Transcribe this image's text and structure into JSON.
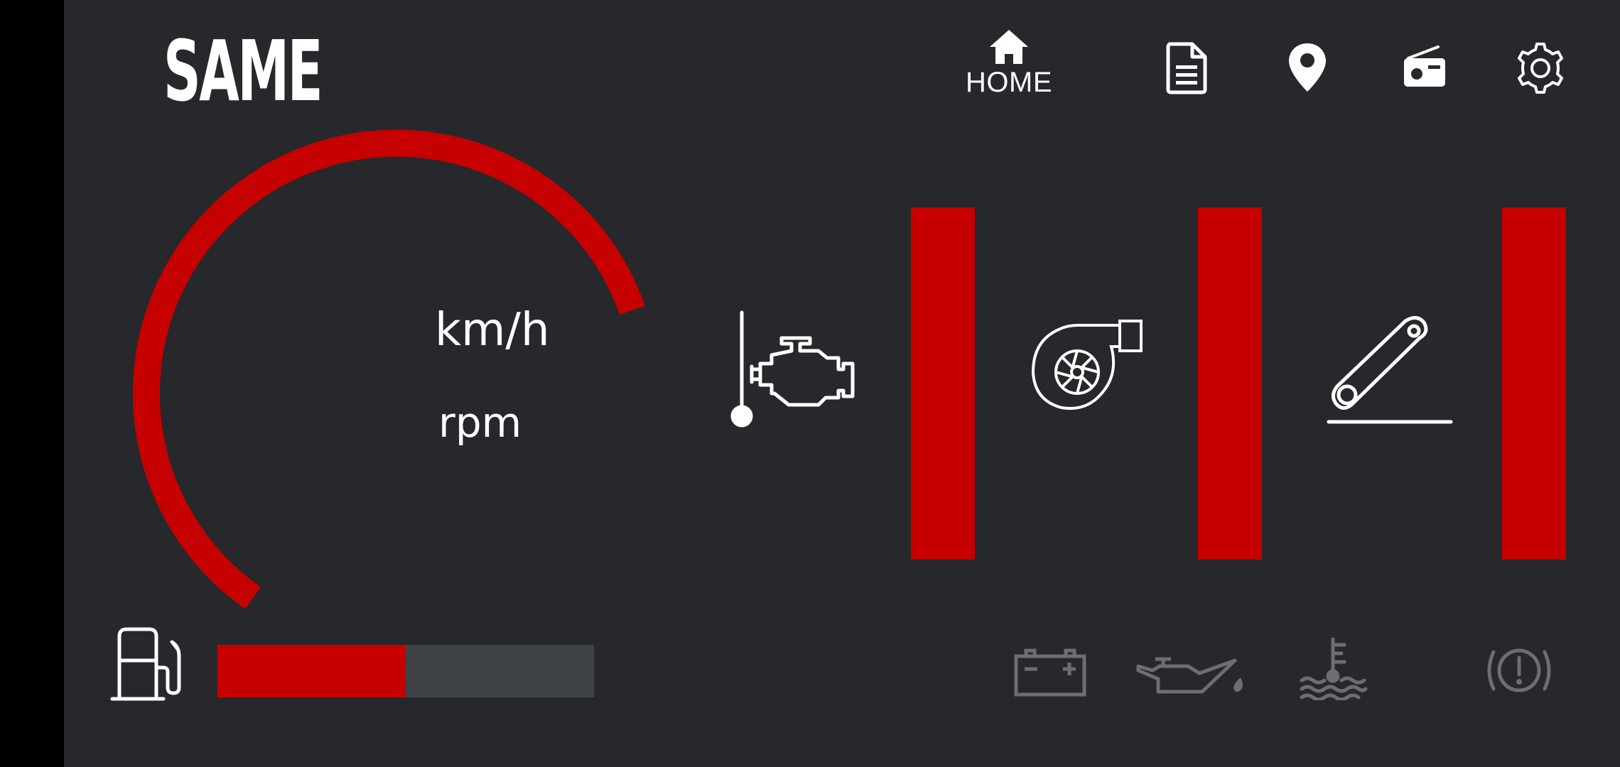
{
  "app": {
    "brand": "SAME"
  },
  "nav": {
    "home_label": "HOME",
    "items": [
      {
        "icon": "home-icon",
        "label": "HOME"
      },
      {
        "icon": "document-icon"
      },
      {
        "icon": "location-pin-icon"
      },
      {
        "icon": "radio-icon"
      },
      {
        "icon": "settings-gear-icon"
      }
    ]
  },
  "gauge": {
    "speed_unit": "km/h",
    "rpm_unit": "rpm"
  },
  "indicators": {
    "engine_temp": {
      "icon": "engine-temperature-icon"
    },
    "turbo": {
      "icon": "turbo-icon"
    },
    "pedal": {
      "icon": "pedal-icon"
    }
  },
  "fuel": {
    "icon": "fuel-pump-icon",
    "level": 0.5
  },
  "warnings": [
    {
      "icon": "battery-icon"
    },
    {
      "icon": "oil-pressure-icon"
    },
    {
      "icon": "coolant-temperature-icon"
    },
    {
      "icon": "brake-warning-icon"
    }
  ],
  "colors": {
    "background": "#26282b",
    "accent": "#c60000",
    "track": "#404346",
    "warning_inactive": "#6b6e72",
    "foreground": "#ffffff"
  }
}
